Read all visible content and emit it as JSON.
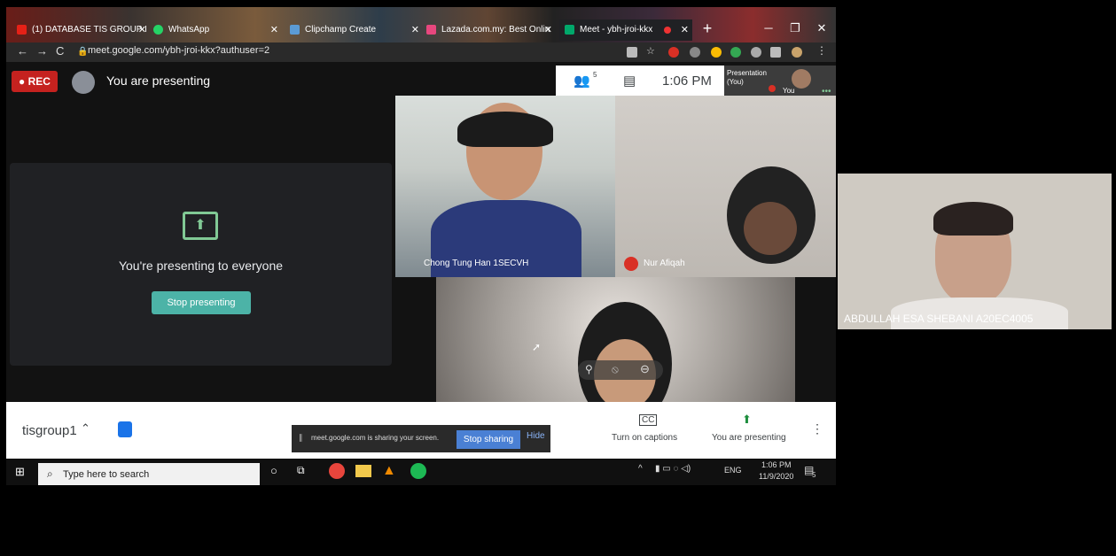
{
  "browser": {
    "tabs": [
      {
        "label": "(1) DATABASE TIS GROUP I",
        "icon": "youtube-icon"
      },
      {
        "label": "WhatsApp",
        "icon": "whatsapp-icon"
      },
      {
        "label": "Clipchamp Create",
        "icon": "clipchamp-icon"
      },
      {
        "label": "Lazada.com.my: Best Onlin",
        "icon": "lazada-icon"
      },
      {
        "label": "Meet - ybh-jroi-kkx",
        "icon": "meet-icon"
      }
    ],
    "url": "meet.google.com/ybh-jroi-kkx?authuser=2"
  },
  "meet": {
    "rec_label": "REC",
    "presenting_status": "You are presenting",
    "participant_count": "5",
    "time": "1:06 PM",
    "self_tile_label": "Presentation (You)",
    "self_name": "You",
    "panel": {
      "title": "You're presenting to everyone",
      "stop_button": "Stop presenting"
    },
    "participants": [
      {
        "name": "Chong Tung Han 1SECVH"
      },
      {
        "name": "Nur Afiqah"
      },
      {
        "name": ""
      }
    ],
    "bottom": {
      "meeting_code": "tisgroup1",
      "captions_label": "Turn on captions",
      "presenting_label": "You are presenting"
    },
    "share_notice": {
      "text": "meet.google.com is sharing your screen.",
      "stop_label": "Stop sharing",
      "hide_label": "Hide"
    }
  },
  "taskbar": {
    "search_placeholder": "Type here to search",
    "lang": "ENG",
    "time": "1:06 PM",
    "date": "11/9/2020",
    "notification_count": "5"
  },
  "external_participant": {
    "name": "ABDULLAH ESA SHEBANI A20EC4005"
  },
  "colors": {
    "rec": "#c5221f",
    "stop_presenting": "#4cb3a7",
    "stop_sharing": "#4a80d4",
    "meet_green": "#81c995"
  }
}
